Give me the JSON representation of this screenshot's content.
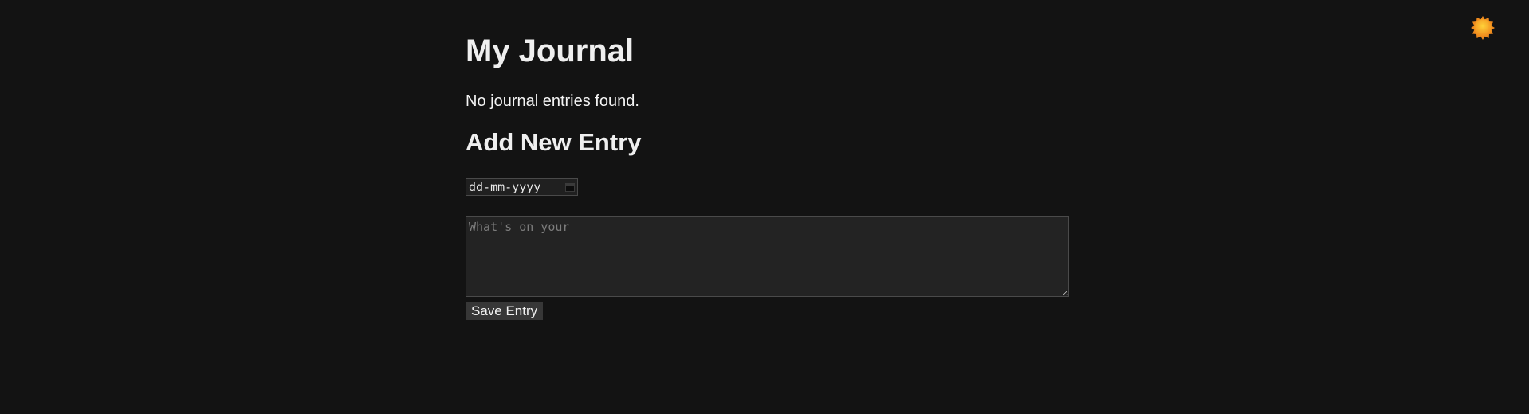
{
  "page": {
    "title": "My Journal",
    "empty_message": "No journal entries found."
  },
  "form": {
    "heading": "Add New Entry",
    "date_placeholder": "dd-mm-yyyy",
    "entry_placeholder": "What's on your",
    "save_label": "Save Entry"
  },
  "icons": {
    "theme_toggle": "sun-icon",
    "date_picker": "calendar-icon"
  },
  "colors": {
    "background": "#131313",
    "sun": "#f5a623"
  }
}
